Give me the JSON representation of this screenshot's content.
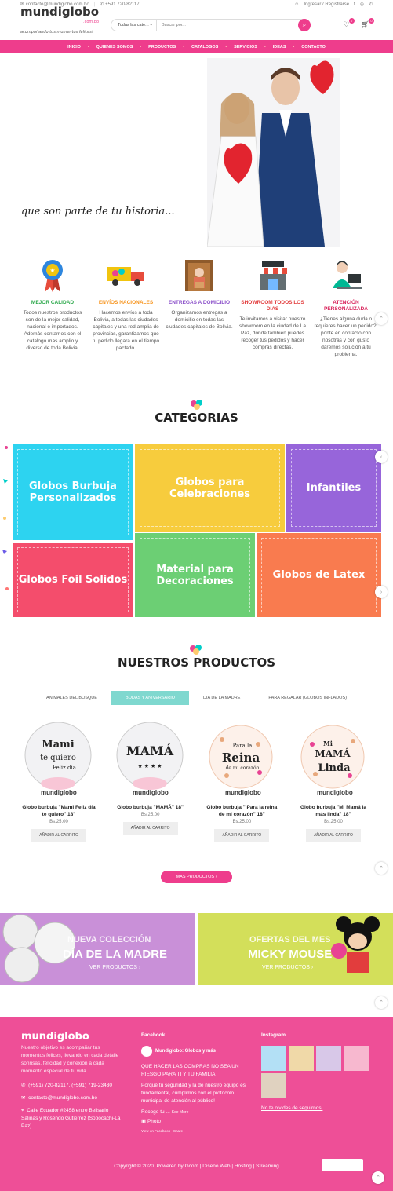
{
  "topbar": {
    "email": "contacto@mundiglobo.com.bo",
    "phone": "+591 720-82117",
    "login": "Ingresar / Registrarse"
  },
  "logo": {
    "main": "mundiglobo",
    "domain": ".com.bo",
    "tagline": "acompañando tus momentos felices!"
  },
  "search": {
    "category": "Todas las cate...",
    "placeholder": "Buscar por..."
  },
  "header_icons": {
    "wishlist_count": "0",
    "cart_count": "0"
  },
  "nav": [
    "INICIO",
    "QUIENES SOMOS",
    "PRODUCTOS",
    "CATALOGOS",
    "SERVICIOS",
    "IDEAS",
    "CONTACTO"
  ],
  "hero": {
    "caption": "que son parte de tu historia..."
  },
  "features": [
    {
      "title": "MEJOR CALIDAD",
      "color": "#2ba84a",
      "text": "Todos nuestros productos son de la mejor calidad, nacional e importados. Además contamos con el catalogo mas amplio y diverso de toda Bolivia."
    },
    {
      "title": "ENVÍOS NACIONALES",
      "color": "#f7941d",
      "text": "Hacemos envíos a toda Bolivia, a todas las ciudades capitales y una red amplia de provincias, garantizamos que tu pedido llegara en el tiempo pactado."
    },
    {
      "title": "ENTREGAS A DOMICILIO",
      "color": "#8a4fc9",
      "text": "Organizamos entregas a domicilio en todas las ciudades capitales de Bolivia."
    },
    {
      "title": "SHOWROOM TODOS LOS DIAS",
      "color": "#e23d3d",
      "text": "Te invitamos a visitar nuestro showroom en la ciudad de La Paz, donde también puedes recoger tus pedidos y hacer compras directas."
    },
    {
      "title": "ATENCIÓN PERSONALIZADA",
      "color": "#d9265d",
      "text": "¿Tienes alguna duda o requieres hacer un pedido?, ponte en contacto con nosotras y con gusto daremos solución a tu problema."
    }
  ],
  "categories_title": "CATEGORIAS",
  "categories": [
    {
      "label": "Globos Burbuja Personalizados",
      "color": "#2dd3f0"
    },
    {
      "label": "Globos para Celebraciones",
      "color": "#f7cc3d"
    },
    {
      "label": "Infantiles",
      "color": "#9765da"
    },
    {
      "label": "Globos Foil Solidos",
      "color": "#f44d6c"
    },
    {
      "label": "Material para Decoraciones",
      "color": "#6ccf74"
    },
    {
      "label": "Globos de Latex",
      "color": "#f97b4f"
    }
  ],
  "products_title": "NUESTROS PRODUCTOS",
  "tabs": [
    "ANIMALES DEL BOSQUE",
    "BODAS Y ANIVERSARIO",
    "DIA DE LA MADRE",
    "PARA REGALAR (GLOBOS INFLADOS)"
  ],
  "products": [
    {
      "name": "Globo burbuja \"Mami Feliz día te quiero\" 18\"",
      "price": "Bs.25.00",
      "button": "AÑADIR AL CARRITO",
      "art1": "Mami",
      "art2": "te quiero",
      "art3": "Feliz día"
    },
    {
      "name": "Globo burbuja \"MAMÁ\" 18\"",
      "price": "Bs.25.00",
      "button": "AÑADIR AL CARRITO",
      "art1": "MAMÁ",
      "art2": "",
      "art3": ""
    },
    {
      "name": "Globo burbuja \" Para la reina de mi corazón\" 18\"",
      "price": "Bs.25.00",
      "button": "AÑADIR AL CARRITO",
      "art1": "Para la",
      "art2": "Reina",
      "art3": "de mi corazón"
    },
    {
      "name": "Globo burbuja \"Mi Mamá la más linda\" 18\"",
      "price": "Bs.25.00",
      "button": "AÑADIR AL CARRITO",
      "art1": "Mi",
      "art2": "MAMÁ",
      "art3": "Linda"
    }
  ],
  "more_button": "MAS PRODUCTOS ›",
  "banner_left": {
    "line1": "NUEVA COLECCIÓN",
    "line2": "DÍA DE LA MADRE",
    "link": "VER PRODUCTOS ›",
    "color": "#c990d8"
  },
  "banner_right": {
    "line1": "OFERTAS DEL MES",
    "line2": "MICKY MOUSE",
    "link": "VER PRODUCTOS ›",
    "color": "#d3df5a"
  },
  "footer": {
    "about": "Nuestro objetivo es acompañar tus momentos felices, llevando en cada detalle sonrisas, felicidad y conexión a cada momento especial de tu vida.",
    "phones": "(+591) 720-82117, (+591) 719-23430",
    "email": "contacto@mundiglobo.com.bo",
    "address": "Calle Ecuador #2458 entre Belisario Salinas y Rosendo Gutierrez (Sopocachi-La Paz)",
    "facebook_title": "Facebook",
    "fb_page": "Mundiglobo: Globos y más",
    "fb_post1": "QUE HACER LAS COMPRAS NO SEA UN RIESGO PARA TI Y TU FAMILIA",
    "fb_post2": "Porqué tú seguridad y la de nuestro equipo es fundamental, cumplimos con el protocolo municipal de atención al público!",
    "fb_recoge": "Recoge tu ...",
    "fb_see_more": "See More",
    "fb_photo": "Photo",
    "fb_view": "View on Facebook · Share",
    "instagram_title": "Instagram",
    "instagram_follow": "No te olvides de seguirnos!",
    "copyright": "Copyright © 2020. Powered by Gcom | Diseño Web | Hosting | Streaming"
  }
}
